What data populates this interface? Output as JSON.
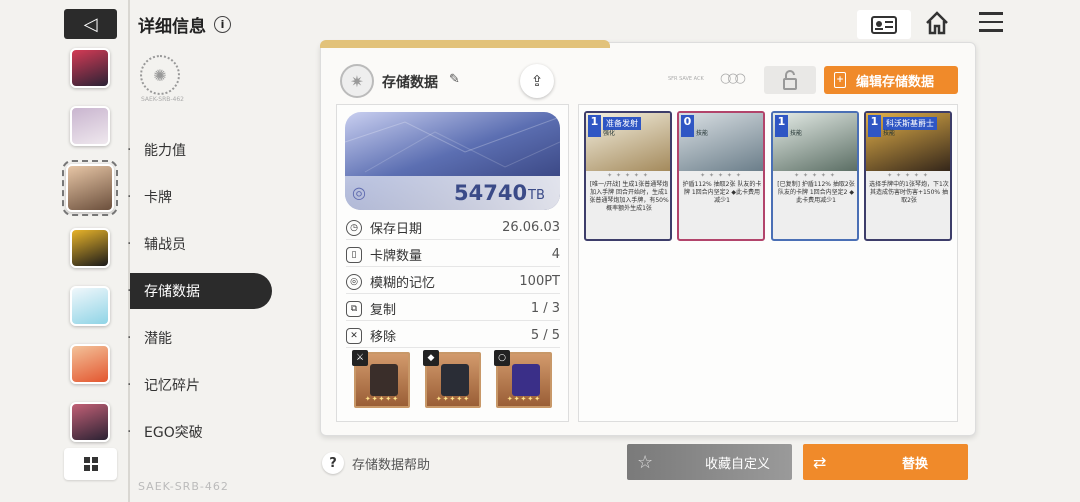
{
  "header": {
    "title": "详细信息",
    "back_icon": "◁",
    "info_icon": "i"
  },
  "emblem_caption": "SAEK-SRB-462",
  "avatars": [
    {
      "colors": [
        "#2a2235",
        "#d43b55"
      ]
    },
    {
      "colors": [
        "#efe8ee",
        "#c9b5cf"
      ]
    },
    {
      "colors": [
        "#6b4f3c",
        "#e7c6a6"
      ],
      "selected": true
    },
    {
      "colors": [
        "#1a1a1a",
        "#e8b42a"
      ]
    },
    {
      "colors": [
        "#8fd4e6",
        "#f0f7fb"
      ]
    },
    {
      "colors": [
        "#e3562f",
        "#f3c29a"
      ]
    },
    {
      "colors": [
        "#2b2233",
        "#c26076"
      ]
    }
  ],
  "menu": [
    {
      "label": "能力值"
    },
    {
      "label": "卡牌"
    },
    {
      "label": "辅战员"
    },
    {
      "label": "存储数据",
      "active": true
    },
    {
      "label": "潜能"
    },
    {
      "label": "记忆碎片"
    },
    {
      "label": "EGO突破"
    }
  ],
  "watermark": "SAEK-SRB-462",
  "panel": {
    "title": "存储数据",
    "edit_label": "编辑存储数据",
    "tiny_text": "SFR SAVE ACK",
    "banner_value": "54740",
    "banner_unit": "TB"
  },
  "stats": [
    {
      "label": "保存日期",
      "value": "26.06.03",
      "icon": "◷"
    },
    {
      "label": "卡牌数量",
      "value": "4",
      "icon": "▯"
    },
    {
      "label": "模糊的记忆",
      "value": "100PT",
      "icon": "◎"
    },
    {
      "label": "复制",
      "value": "1 / 3",
      "icon": "⧉"
    },
    {
      "label": "移除",
      "value": "5 / 5",
      "icon": "✕"
    }
  ],
  "equipment": [
    {
      "badge": "⚔",
      "art": "#3a2e2a",
      "stars": "✦✦✦✦✦"
    },
    {
      "badge": "◆",
      "art": "#2a2d36",
      "stars": "✦✦✦✦✦"
    },
    {
      "badge": "○",
      "art": "#3a2f88",
      "stars": "✦✦✦✦✦"
    }
  ],
  "cards": [
    {
      "cost": "1",
      "name": "准备发射",
      "type": "强化",
      "desc": "[唯一/开战] 生成1张普通琴炮加入手牌 回合开始时，生成1张普通琴炮加入手牌，有50%概率额外生成1张",
      "top": [
        "#f4f0e0",
        "#a48a5c"
      ],
      "border": "#3d3d6a"
    },
    {
      "cost": "0",
      "name": "",
      "type": "技能",
      "desc": "护盾112% 抽取2张 队友的卡牌 1回合内坚定2 ◆此卡费用减少1",
      "top": [
        "#d9dfe3",
        "#6b7e8a"
      ],
      "border": "#b2446b"
    },
    {
      "cost": "1",
      "name": "",
      "type": "技能",
      "desc": "[已复制] 护盾112% 抽取2张 队友的卡牌 1回合内坚定2 ◆此卡费用减少1",
      "top": [
        "#e4ebe6",
        "#5b6e64"
      ],
      "border": "#4a6fb5"
    },
    {
      "cost": "1",
      "name": "科沃斯基爵士",
      "type": "技能",
      "desc": "选择手牌中的1张琴炮，下1次其造成伤害时伤害+150% 抽取2张",
      "top": [
        "#e3b14a",
        "#34261a"
      ],
      "border": "#3d3d6a"
    }
  ],
  "footer": {
    "help": "存储数据帮助",
    "collect": "收藏自定义",
    "replace": "替换"
  }
}
